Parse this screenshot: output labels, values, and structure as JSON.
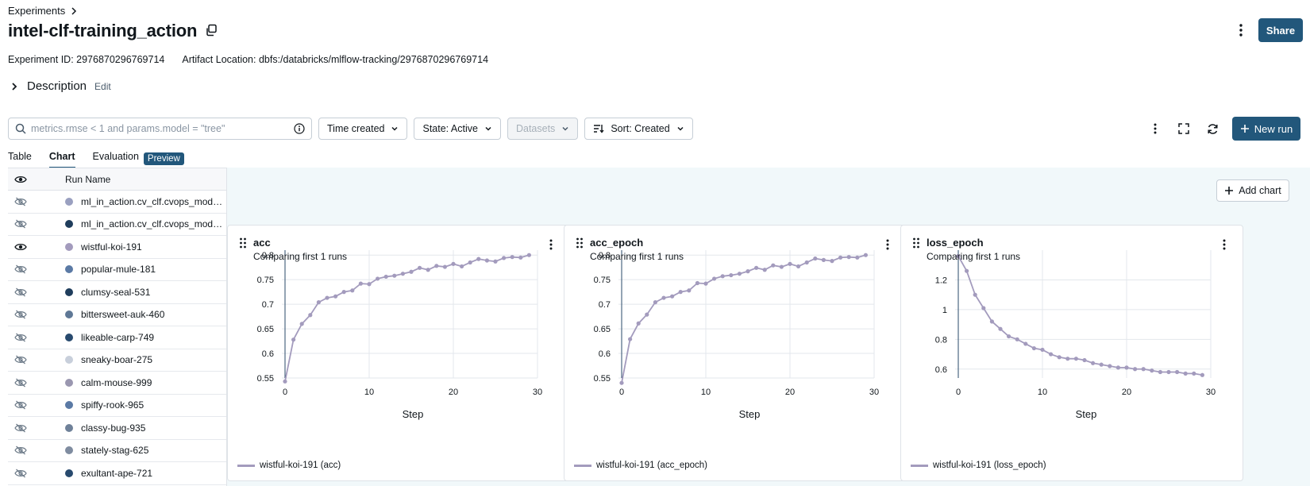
{
  "breadcrumb": {
    "label": "Experiments"
  },
  "header": {
    "title": "intel-clf-training_action",
    "share_label": "Share"
  },
  "meta": {
    "experiment_id": "Experiment ID: 2976870296769714",
    "artifact_location": "Artifact Location: dbfs:/databricks/mlflow-tracking/2976870296769714"
  },
  "description": {
    "label": "Description",
    "edit": "Edit"
  },
  "toolbar": {
    "search_placeholder": "metrics.rmse < 1 and params.model = \"tree\"",
    "time_created": "Time created",
    "state": "State: Active",
    "datasets": "Datasets",
    "sort": "Sort: Created",
    "new_run": "New run"
  },
  "tabs": {
    "table": "Table",
    "chart": "Chart",
    "evaluation": "Evaluation",
    "preview": "Preview"
  },
  "runs": {
    "header": "Run Name",
    "items": [
      {
        "name": "ml_in_action.cv_clf.cvops_model_training",
        "color": "#9aa0c0",
        "visible": false
      },
      {
        "name": "ml_in_action.cv_clf.cvops_model_training",
        "color": "#1f3d5c",
        "visible": false
      },
      {
        "name": "wistful-koi-191",
        "color": "#a39bbd",
        "visible": true
      },
      {
        "name": "popular-mule-181",
        "color": "#5b7aa5",
        "visible": false
      },
      {
        "name": "clumsy-seal-531",
        "color": "#1f3d5c",
        "visible": false
      },
      {
        "name": "bittersweet-auk-460",
        "color": "#5f7896",
        "visible": false
      },
      {
        "name": "likeable-carp-749",
        "color": "#284a6e",
        "visible": false
      },
      {
        "name": "sneaky-boar-275",
        "color": "#c8cfdb",
        "visible": false
      },
      {
        "name": "calm-mouse-999",
        "color": "#9a97b0",
        "visible": false
      },
      {
        "name": "spiffy-rook-965",
        "color": "#5b7aa5",
        "visible": false
      },
      {
        "name": "classy-bug-935",
        "color": "#6f8199",
        "visible": false
      },
      {
        "name": "stately-stag-625",
        "color": "#7f8ca0",
        "visible": false
      },
      {
        "name": "exultant-ape-721",
        "color": "#284a6e",
        "visible": false
      }
    ]
  },
  "add_chart": "Add chart",
  "colors": {
    "accent": "#22577b",
    "series": "#a39bbd"
  },
  "chart_data": [
    {
      "type": "line",
      "title": "acc",
      "subtitle": "Comparing first 1 runs",
      "xlabel": "Step",
      "legend": "wistful-koi-191 (acc)",
      "xlim": [
        0,
        30
      ],
      "ylim": [
        0.55,
        0.81
      ],
      "xticks": [
        0,
        10,
        20,
        30
      ],
      "yticks": [
        0.55,
        0.6,
        0.65,
        0.7,
        0.75,
        0.8
      ],
      "ytick_labels": [
        "0.55",
        "0.6",
        "0.65",
        "0.7",
        "0.75",
        "0.8"
      ],
      "x": [
        0,
        1,
        2,
        3,
        4,
        5,
        6,
        7,
        8,
        9,
        10,
        11,
        12,
        13,
        14,
        15,
        16,
        17,
        18,
        19,
        20,
        21,
        22,
        23,
        24,
        25,
        26,
        27,
        28,
        29
      ],
      "values": [
        0.543,
        0.628,
        0.66,
        0.678,
        0.704,
        0.713,
        0.716,
        0.725,
        0.728,
        0.742,
        0.741,
        0.752,
        0.756,
        0.758,
        0.762,
        0.766,
        0.774,
        0.77,
        0.778,
        0.776,
        0.782,
        0.777,
        0.785,
        0.792,
        0.789,
        0.787,
        0.794,
        0.796,
        0.795,
        0.8
      ]
    },
    {
      "type": "line",
      "title": "acc_epoch",
      "subtitle": "Comparing first 1 runs",
      "xlabel": "Step",
      "legend": "wistful-koi-191 (acc_epoch)",
      "xlim": [
        0,
        30
      ],
      "ylim": [
        0.55,
        0.81
      ],
      "xticks": [
        0,
        10,
        20,
        30
      ],
      "yticks": [
        0.55,
        0.6,
        0.65,
        0.7,
        0.75,
        0.8
      ],
      "ytick_labels": [
        "0.55",
        "0.6",
        "0.65",
        "0.7",
        "0.75",
        "0.8"
      ],
      "x": [
        0,
        1,
        2,
        3,
        4,
        5,
        6,
        7,
        8,
        9,
        10,
        11,
        12,
        13,
        14,
        15,
        16,
        17,
        18,
        19,
        20,
        21,
        22,
        23,
        24,
        25,
        26,
        27,
        28,
        29
      ],
      "values": [
        0.54,
        0.629,
        0.661,
        0.679,
        0.704,
        0.713,
        0.716,
        0.725,
        0.728,
        0.743,
        0.742,
        0.752,
        0.757,
        0.759,
        0.762,
        0.767,
        0.774,
        0.77,
        0.779,
        0.776,
        0.782,
        0.777,
        0.785,
        0.793,
        0.79,
        0.788,
        0.795,
        0.796,
        0.795,
        0.8
      ]
    },
    {
      "type": "line",
      "title": "loss_epoch",
      "subtitle": "Comparing first 1 runs",
      "xlabel": "Step",
      "legend": "wistful-koi-191 (loss_epoch)",
      "xlim": [
        0,
        30
      ],
      "ylim": [
        0.54,
        1.4
      ],
      "xticks": [
        0,
        10,
        20,
        30
      ],
      "yticks": [
        0.6,
        0.8,
        1.0,
        1.2
      ],
      "ytick_labels": [
        "0.6",
        "0.8",
        "1",
        "1.2"
      ],
      "x": [
        0,
        1,
        2,
        3,
        4,
        5,
        6,
        7,
        8,
        9,
        10,
        11,
        12,
        13,
        14,
        15,
        16,
        17,
        18,
        19,
        20,
        21,
        22,
        23,
        24,
        25,
        26,
        27,
        28,
        29
      ],
      "values": [
        1.36,
        1.26,
        1.1,
        1.01,
        0.92,
        0.87,
        0.82,
        0.8,
        0.77,
        0.74,
        0.73,
        0.7,
        0.68,
        0.67,
        0.67,
        0.66,
        0.64,
        0.63,
        0.62,
        0.61,
        0.61,
        0.6,
        0.6,
        0.59,
        0.58,
        0.58,
        0.58,
        0.57,
        0.57,
        0.56
      ]
    }
  ]
}
